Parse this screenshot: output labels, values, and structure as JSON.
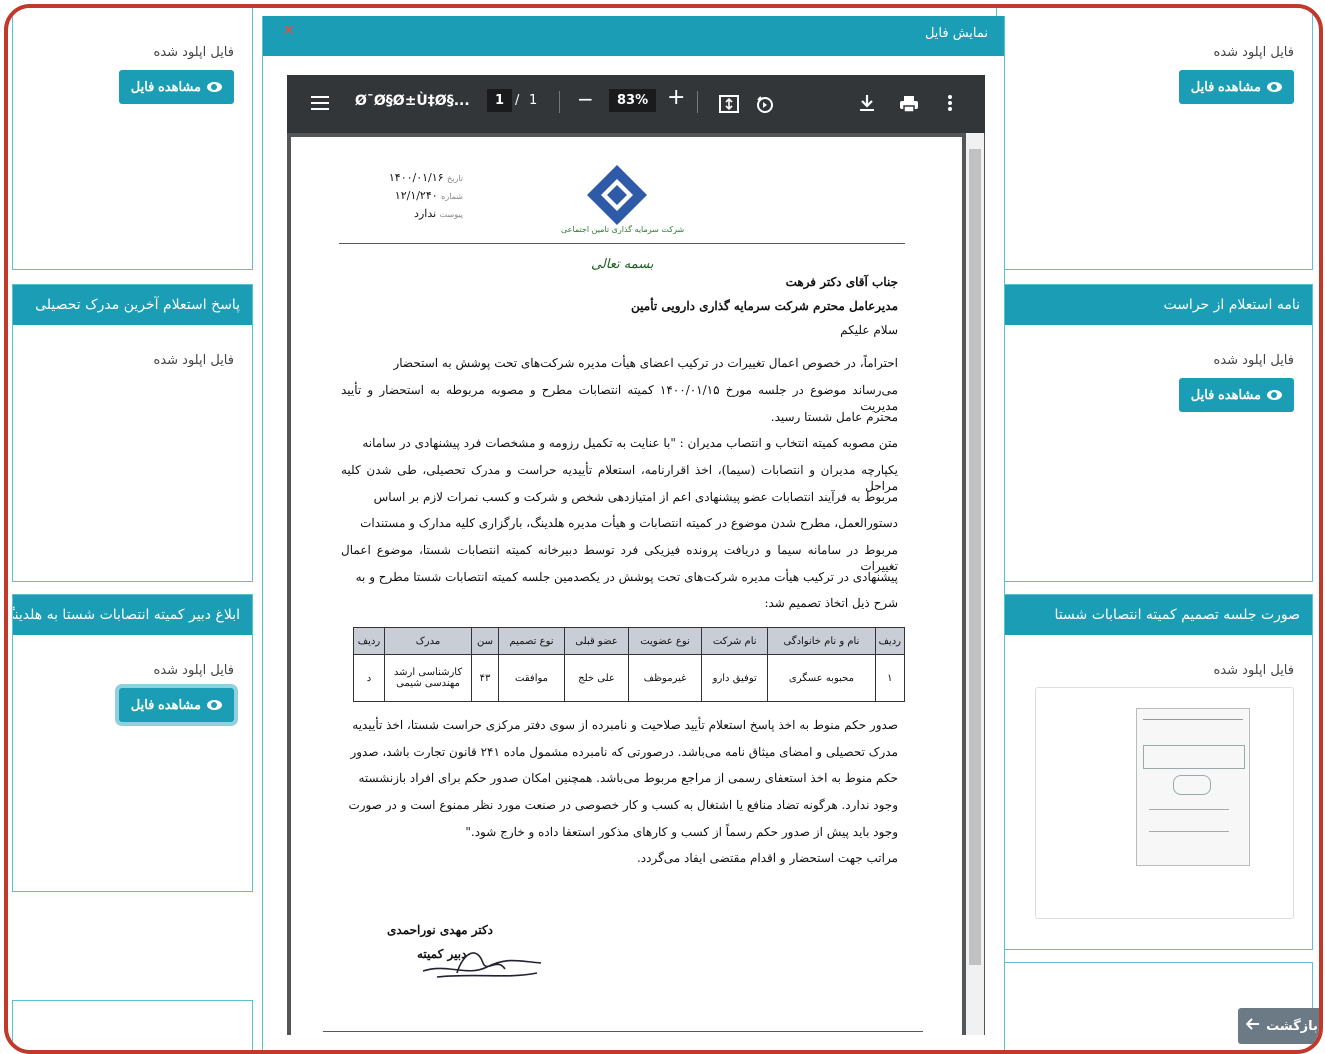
{
  "common": {
    "uploaded_label": "فایل اپلود شده",
    "view_file_label": "مشاهده فایل"
  },
  "left_cards": [
    {
      "header": ""
    },
    {
      "header": "پاسخ استعلام آخرین مدرک تحصیلی"
    },
    {
      "header": "ابلاغ دبیر کمیته انتصابات شستا به هلدینگ"
    }
  ],
  "right_cards": [
    {
      "header": ""
    },
    {
      "header": "نامه استعلام از حراست"
    },
    {
      "header": "صورت جلسه تصمیم کمیته انتصابات شستا"
    }
  ],
  "back_button": "بازگشت",
  "modal": {
    "title": "نمایش فایل",
    "close": "×"
  },
  "pdf_toolbar": {
    "filename": "Ø¯Ø§Ø±Ù‡Ø§...",
    "page_current": "1",
    "page_sep": "/",
    "page_total": "1",
    "zoom": "83%"
  },
  "letter": {
    "date_label": "تاریخ",
    "date": "۱۴۰۰/۰۱/۱۶",
    "number_label": "شماره",
    "number": "۱۲/۱/۲۴۰",
    "attach_label": "پیوست",
    "attach": "ندارد",
    "company_caption": "شرکت سرمایه گذاری تامین اجتماعی",
    "bismillah": "بسمه تعالی",
    "salutation_1": "جناب آقای دکتر فرهت",
    "salutation_2": "مدیرعامل محترم شرکت سرمایه گذاری دارویی تأمین",
    "greeting": "سلام علیکم",
    "body": [
      "احتراماً، در خصوص اعمال تغییرات در ترکیب اعضای هیأت مدیره شرکت‌های تحت پوشش به استحضار",
      "می‌رساند موضوع در جلسه مورخ ۱۴۰۰/۰۱/۱۵ کمیته انتصابات مطرح و مصوبه مربوطه به استحضار و تأیید مدیریت",
      "محترم عامل شستا رسید.",
      "متن مصوبه کمیته انتخاب و انتصاب مدیران : \"با عنایت به تکمیل رزومه و مشخصات فرد پیشنهادی در سامانه",
      "یکپارچه مدیران و انتصابات (سیما)، اخذ اقرارنامه، استعلام تأییدیه حراست و مدرک تحصیلی، طی شدن کلیه مراحل",
      "مربوط به فرآیند انتصابات عضو پیشنهادی اعم از امتیازدهی شخص و شرکت و کسب نمرات لازم بر اساس",
      "دستورالعمل، مطرح شدن موضوع در کمیته انتصابات و هیأت مدیره هلدینگ، بارگزاری کلیه مدارک و مستندات",
      "مربوط در سامانه سیما و دریافت پرونده فیزیکی فرد توسط دبیرخانه کمیته انتصابات شستا، موضوع اعمال تغییرات",
      "پیشنهادی در ترکیب هیأت مدیره شرکت‌های تحت پوشش در یکصدمین جلسه کمیته انتصابات شستا مطرح و به",
      "شرح ذیل اتخاذ تصمیم شد:"
    ],
    "table_headers": [
      "ردیف",
      "نام و نام خانوادگی",
      "نام شرکت",
      "نوع عضویت",
      "عضو قبلی",
      "نوع تصمیم",
      "سن",
      "مدرک",
      "ردیف"
    ],
    "table_row": [
      "۱",
      "محبوبه عسگری",
      "توفیق دارو",
      "غیرموظف",
      "علی خلج",
      "موافقت",
      "۴۳",
      "کارشناسی ارشد مهندسی شیمی",
      "د"
    ],
    "body2": [
      "صدور حکم منوط به اخذ پاسخ استعلام تأیید صلاحیت و نامبرده از سوی دفتر مرکزی حراست شستا، اخذ تأییدیه",
      "مدرک تحصیلی و امضای میثاق نامه می‌باشد. درصورتی که نامبرده مشمول ماده ۲۴۱ قانون تجارت باشد، صدور",
      "حکم منوط به اخذ استعفای رسمی از مراجع مربوط می‌باشد. همچنین امکان صدور حکم برای افراد بازنشسته",
      "وجود ندارد. هرگونه تضاد منافع یا اشتغال به کسب و کار خصوصی در صنعت مورد نظر ممنوع است و در صورت",
      "وجود باید پیش از صدور حکم رسماً از کسب و کارهای مذکور استعفا داده و خارج شود.\"",
      "مراتب جهت استحضار و اقدام مقتضی ایفاد می‌گردد."
    ],
    "signer_name": "دکتر مهدی نوراحمدی",
    "signer_title": "دبیر کمیته"
  },
  "colors": {
    "teal": "#1a9db5",
    "frame_red": "#c0392b",
    "pdf_bg": "#525659",
    "pdf_toolbar": "#323639"
  }
}
